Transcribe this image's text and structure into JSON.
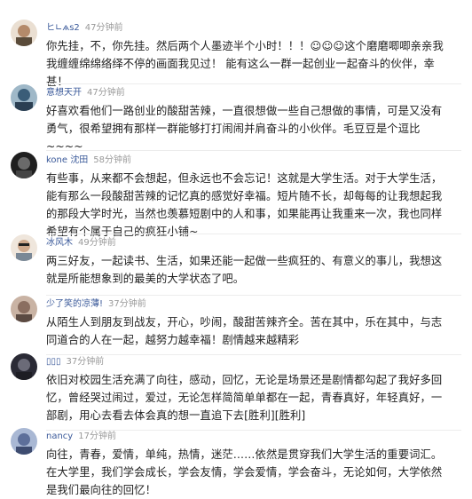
{
  "comments": [
    {
      "username": "ヒ∟ѧѕ2",
      "time": "47分钟前",
      "text": "你先挂，不，你先挂。然后两个人墨迹半个小时！！！☺☺☺这个磨磨唧唧亲亲我我缠缠绵绵络绎不停的画面我见过！ 能有这么一群一起创业一起奋斗的伙伴，幸甚！",
      "avatar_color": "#d7c2a8"
    },
    {
      "username": "意想天开",
      "time": "47分钟前",
      "text": "好喜欢看他们一路创业的酸甜苦辣，一直很想做一些自己想做的事情，可是又没有勇气，很希望拥有那样一群能够打打闹闹并肩奋斗的小伙伴。毛豆豆是个逗比~~~~",
      "avatar_color": "#3a5d78"
    },
    {
      "username": "kone 沈田",
      "time": "58分钟前",
      "text": "有些事，从来都不会想起，但永远也不会忘记！这就是大学生活。对于大学生活，能有那么一段酸甜苦辣的记忆真的感觉好幸福。短片随不长，却每每的让我想起我的那段大学时光，当然也羡慕短剧中的人和事，如果能再让我重来一次，我也同样希望有个属于自己的疯狂小铺~",
      "avatar_color": "#2a2a2a"
    },
    {
      "username": "冰风木",
      "time": "49分钟前",
      "text": "两三好友，一起读书、生活，如果还能一起做一些疯狂的、有意义的事儿，我想这就是所能想象到的最美的大学状态了吧。",
      "avatar_color": "#cfa98d"
    },
    {
      "username": "少了笑的凉薄!",
      "time": "37分钟前",
      "text": "从陌生人到朋友到战友，开心，吵闹，酸甜苦辣齐全。苦在其中，乐在其中，与志同道合的人在一起，越努力越幸福！剧情越来越精彩",
      "avatar_color": "#8a6e60"
    },
    {
      "username": "▯▯▯",
      "time": "37分钟前",
      "text": "依旧对校园生活充满了向往，感动，回忆，无论是场景还是剧情都勾起了我好多回忆，曾经哭过闹过，爱过，无论怎样简简单单都在一起，青春真好，年轻真好，一部剧，用心去看去体会真的想一直追下去[胜利][胜利]",
      "avatar_color": "#3c3c46"
    },
    {
      "username": "nancy",
      "time": "17分钟前",
      "text": "向往，青春，爱情，单纯，热情，迷茫……依然是贯穿我们大学生活的重要词汇。在大学里，我们学会成长，学会友情，学会爱情，学会奋斗，无论如何，大学依然是我们最向往的回忆！",
      "avatar_color": "#5d6f9a"
    }
  ]
}
